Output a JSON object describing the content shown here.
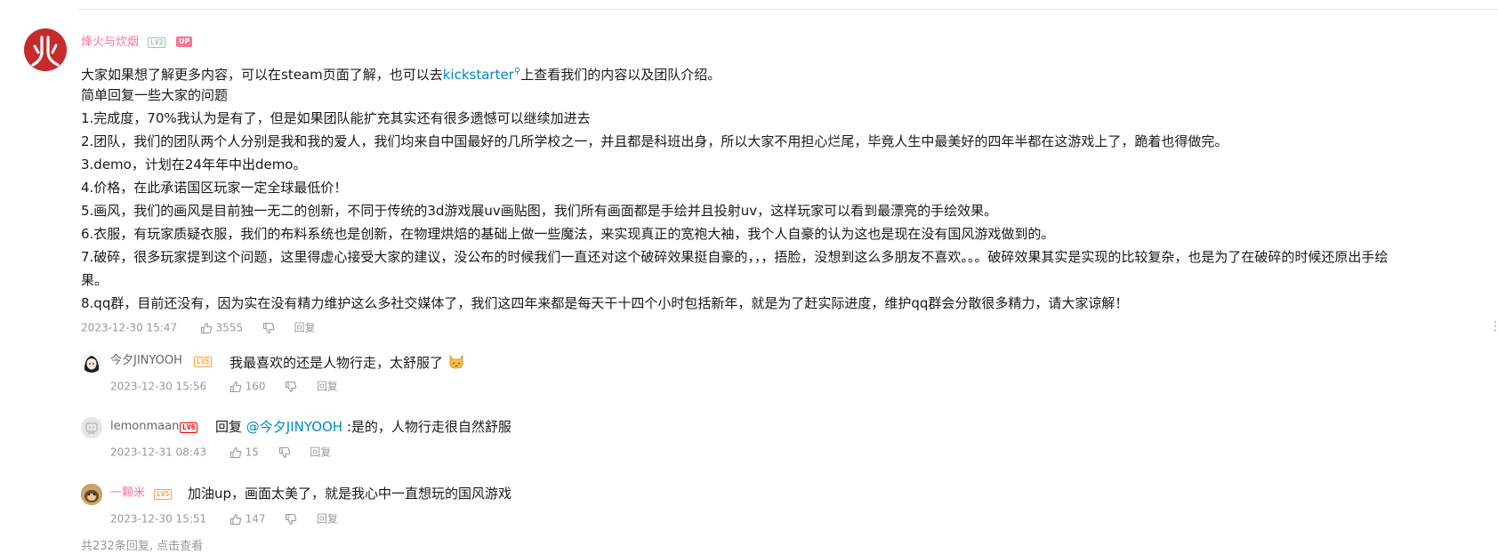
{
  "main_comment": {
    "username": "烽火与炊烟",
    "level": "LV2",
    "up_badge": "UP",
    "lines": [
      {
        "before": "大家如果想了解更多内容，可以在steam页面了解，也可以去",
        "link": "kickstarter",
        "after": "上查看我们的内容以及团队介绍。"
      },
      {
        "text": "简单回复一些大家的问题"
      },
      {
        "text": "1.完成度，70%我认为是有了，但是如果团队能扩充其实还有很多遗憾可以继续加进去"
      },
      {
        "text": "2.团队，我们的团队两个人分别是我和我的爱人，我们均来自中国最好的几所学校之一，并且都是科班出身，所以大家不用担心烂尾，毕竟人生中最美好的四年半都在这游戏上了，跪着也得做完。"
      },
      {
        "text": "3.demo，计划在24年年中出demo。"
      },
      {
        "text": "4.价格，在此承诺国区玩家一定全球最低价！"
      },
      {
        "text": "5.画风，我们的画风是目前独一无二的创新，不同于传统的3d游戏展uv画贴图，我们所有画面都是手绘并且投射uv，这样玩家可以看到最漂亮的手绘效果。"
      },
      {
        "text": "6.衣服，有玩家质疑衣服，我们的布料系统也是创新，在物理烘焙的基础上做一些魔法，来实现真正的宽袍大袖，我个人自豪的认为这也是现在没有国风游戏做到的。"
      },
      {
        "text": "7.破碎，很多玩家提到这个问题，这里得虚心接受大家的建议，没公布的时候我们一直还对这个破碎效果挺自豪的，，，捂脸，没想到这么多朋友不喜欢。。。破碎效果其实是实现的比较复杂，也是为了在破碎的时候还原出手绘"
      },
      {
        "text": "果。"
      },
      {
        "text": "8.qq群，目前还没有，因为实在没有精力维护这么多社交媒体了，我们这四年来都是每天干十四个小时包括新年，就是为了赶实际进度，维护qq群会分散很多精力，请大家谅解！"
      }
    ],
    "timestamp": "2023-12-30 15:47",
    "likes": "3555",
    "reply_label": "回复"
  },
  "replies": [
    {
      "username": "今夕JINYOOH",
      "level": "LV5",
      "text": "我最喜欢的还是人物行走，太舒服了",
      "emoji": "cat-emoji",
      "timestamp": "2023-12-30 15:56",
      "likes": "160",
      "reply_label": "回复"
    },
    {
      "username": "lemonmaan",
      "level": "LV6",
      "prefix": "回复 ",
      "mention": "@今夕JINYOOH",
      "text": " :是的，人物行走很自然舒服",
      "timestamp": "2023-12-31 08:43",
      "likes": "15",
      "reply_label": "回复"
    },
    {
      "username": "一颗米",
      "level": "LV5",
      "text": "加油up，画面太美了，就是我心中一直想玩的国风游戏",
      "timestamp": "2023-12-30 15:51",
      "likes": "147",
      "reply_label": "回复"
    }
  ],
  "footer_text": "共232条回复, 点击查看",
  "colors": {
    "pink_name": "#fb7299",
    "link": "#008ac5",
    "meta": "#9499a0",
    "lv2": "#8bd29b",
    "lv5": "#ff9f3d",
    "lv6": "#ff0000"
  }
}
